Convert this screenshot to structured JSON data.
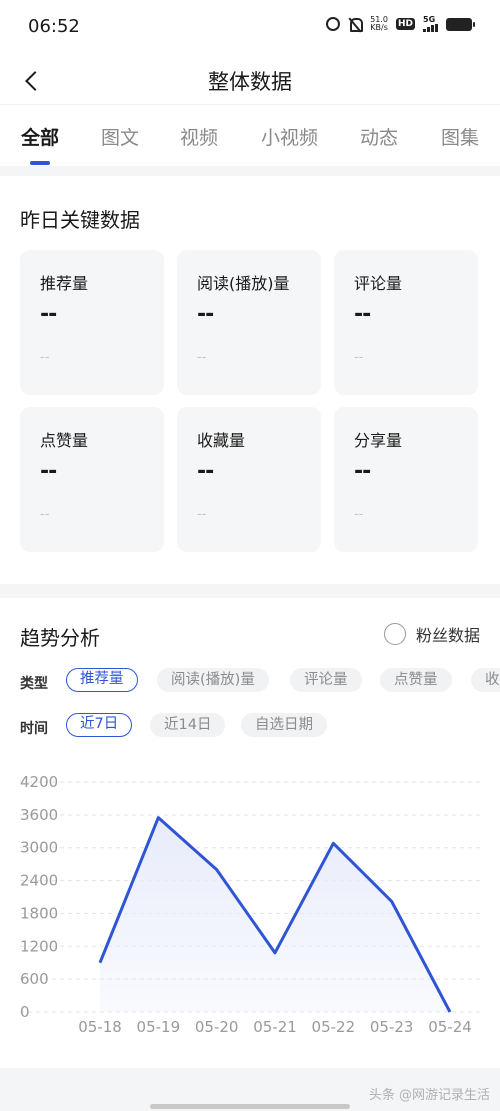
{
  "status_bar": {
    "time": "06:52",
    "speed_value": "51.0",
    "speed_unit": "KB/s",
    "hd": "HD",
    "network": "5G"
  },
  "nav": {
    "title": "整体数据"
  },
  "tabs": [
    {
      "label": "全部",
      "active": true
    },
    {
      "label": "图文",
      "active": false
    },
    {
      "label": "视频",
      "active": false
    },
    {
      "label": "小视频",
      "active": false
    },
    {
      "label": "动态",
      "active": false
    },
    {
      "label": "图集",
      "active": false
    }
  ],
  "key_data": {
    "title": "昨日关键数据",
    "metrics": [
      {
        "label": "推荐量",
        "value": "--",
        "change": "--"
      },
      {
        "label": "阅读(播放)量",
        "value": "--",
        "change": "--"
      },
      {
        "label": "评论量",
        "value": "--",
        "change": "--"
      },
      {
        "label": "点赞量",
        "value": "--",
        "change": "--"
      },
      {
        "label": "收藏量",
        "value": "--",
        "change": "--"
      },
      {
        "label": "分享量",
        "value": "--",
        "change": "--"
      }
    ]
  },
  "trend": {
    "title": "趋势分析",
    "fans_toggle": "粉丝数据",
    "type_label": "类型",
    "type_chips": [
      {
        "label": "推荐量",
        "active": true
      },
      {
        "label": "阅读(播放)量",
        "active": false
      },
      {
        "label": "评论量",
        "active": false
      },
      {
        "label": "点赞量",
        "active": false
      },
      {
        "label": "收",
        "active": false
      }
    ],
    "time_label": "时间",
    "time_chips": [
      {
        "label": "近7日",
        "active": true
      },
      {
        "label": "近14日",
        "active": false
      },
      {
        "label": "自选日期",
        "active": false
      }
    ]
  },
  "chart_data": {
    "type": "area",
    "categories": [
      "05-18",
      "05-19",
      "05-20",
      "05-21",
      "05-22",
      "05-23",
      "05-24"
    ],
    "values": [
      900,
      3550,
      2600,
      1080,
      3080,
      2020,
      0
    ],
    "y_ticks": [
      0,
      600,
      1200,
      1800,
      2400,
      3000,
      3600,
      4200
    ],
    "ylim": [
      0,
      4200
    ],
    "grid": true,
    "line_color": "#2f55d4",
    "fill_color": "#e8ecfa"
  },
  "watermark": "头条 @网游记录生活"
}
